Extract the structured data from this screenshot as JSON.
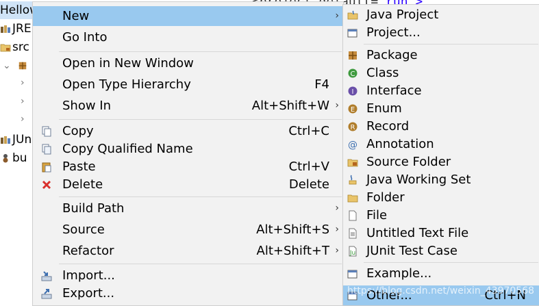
{
  "explorer": {
    "title": "Hellow",
    "rows": [
      "JRE",
      "src",
      "JUn",
      "bu"
    ]
  },
  "editor": {
    "line_prefix": "<project default=",
    "line_value": "\"run\">"
  },
  "context_menu": {
    "items": [
      {
        "label": "New",
        "accel": "",
        "submenu": true,
        "icon": ""
      },
      {
        "label": "Go Into",
        "accel": "",
        "submenu": false,
        "icon": ""
      },
      {
        "label": "Open in New Window",
        "accel": "",
        "submenu": false,
        "icon": ""
      },
      {
        "label": "Open Type Hierarchy",
        "accel": "F4",
        "submenu": false,
        "icon": ""
      },
      {
        "label": "Show In",
        "accel": "Alt+Shift+W",
        "submenu": true,
        "icon": ""
      },
      {
        "label": "Copy",
        "accel": "Ctrl+C",
        "submenu": false,
        "icon": "copy-icon"
      },
      {
        "label": "Copy Qualified Name",
        "accel": "",
        "submenu": false,
        "icon": "copy-qualified-icon"
      },
      {
        "label": "Paste",
        "accel": "Ctrl+V",
        "submenu": false,
        "icon": "paste-icon"
      },
      {
        "label": "Delete",
        "accel": "Delete",
        "submenu": false,
        "icon": "delete-icon"
      },
      {
        "label": "Build Path",
        "accel": "",
        "submenu": true,
        "icon": ""
      },
      {
        "label": "Source",
        "accel": "Alt+Shift+S",
        "submenu": true,
        "icon": ""
      },
      {
        "label": "Refactor",
        "accel": "Alt+Shift+T",
        "submenu": true,
        "icon": ""
      },
      {
        "label": "Import...",
        "accel": "",
        "submenu": false,
        "icon": "import-icon"
      },
      {
        "label": "Export...",
        "accel": "",
        "submenu": false,
        "icon": "export-icon"
      }
    ]
  },
  "new_submenu": {
    "items": [
      {
        "label": "Java Project",
        "accel": "",
        "icon": "java-project-icon"
      },
      {
        "label": "Project...",
        "accel": "",
        "icon": "project-icon"
      },
      {
        "label": "Package",
        "accel": "",
        "icon": "package-icon"
      },
      {
        "label": "Class",
        "accel": "",
        "icon": "class-icon"
      },
      {
        "label": "Interface",
        "accel": "",
        "icon": "interface-icon"
      },
      {
        "label": "Enum",
        "accel": "",
        "icon": "enum-icon"
      },
      {
        "label": "Record",
        "accel": "",
        "icon": "record-icon"
      },
      {
        "label": "Annotation",
        "accel": "",
        "icon": "annotation-icon"
      },
      {
        "label": "Source Folder",
        "accel": "",
        "icon": "source-folder-icon"
      },
      {
        "label": "Java Working Set",
        "accel": "",
        "icon": "working-set-icon"
      },
      {
        "label": "Folder",
        "accel": "",
        "icon": "folder-icon"
      },
      {
        "label": "File",
        "accel": "",
        "icon": "file-icon"
      },
      {
        "label": "Untitled Text File",
        "accel": "",
        "icon": "text-file-icon"
      },
      {
        "label": "JUnit Test Case",
        "accel": "",
        "icon": "junit-icon"
      },
      {
        "label": "Example...",
        "accel": "",
        "icon": "example-icon"
      },
      {
        "label": "Other...",
        "accel": "Ctrl+N",
        "icon": "other-icon"
      }
    ]
  },
  "watermark": "https://blog.csdn.net/weixin_43970568",
  "colors": {
    "highlight": "#99c9ef",
    "menu_bg": "#f2f2f2"
  }
}
